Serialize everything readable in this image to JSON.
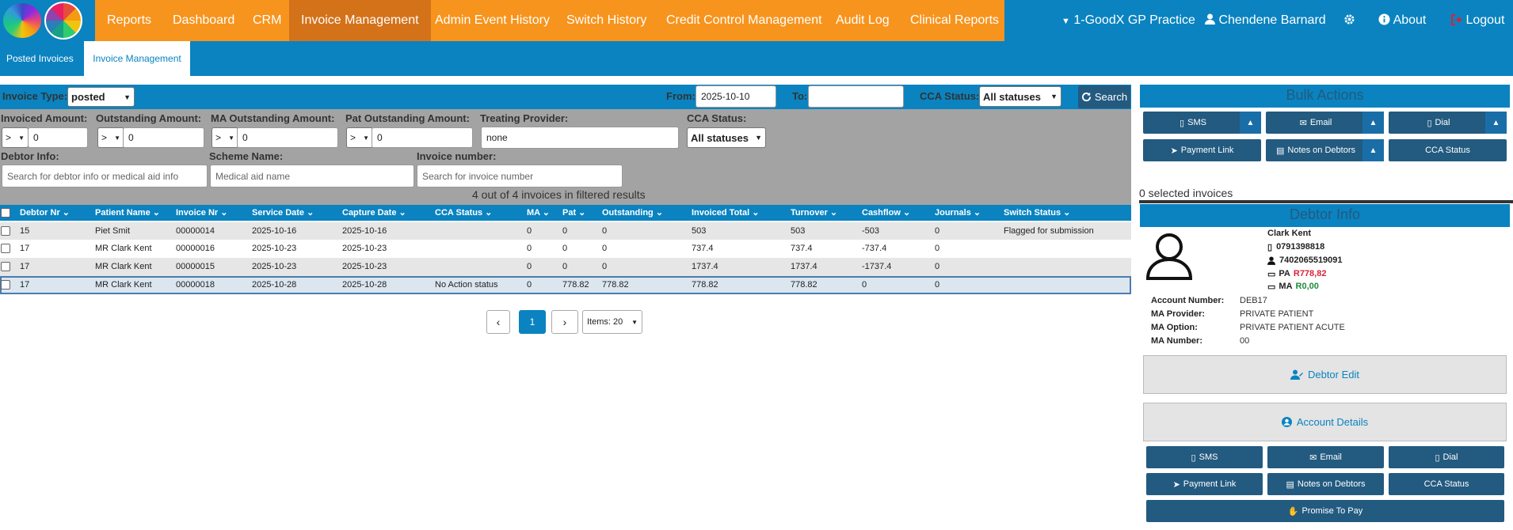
{
  "nav": {
    "items": [
      "Reports",
      "Dashboard",
      "CRM",
      "Invoice Management",
      "Admin Event History",
      "Switch History",
      "Credit Control Management",
      "Audit Log",
      "Clinical Reports"
    ],
    "practice": "1-GoodX GP Practice",
    "user": "Chendene Barnard",
    "about": "About",
    "logout": "Logout"
  },
  "subnav": {
    "tabs": [
      "Posted Invoices",
      "Invoice Management"
    ]
  },
  "filters": {
    "invoice_type_label": "Invoice Type:",
    "invoice_type_value": "posted",
    "from_label": "From:",
    "from_value": "2025-10-10",
    "to_label": "To:",
    "to_value": "",
    "cca_status_label": "CCA Status:",
    "cca_status_value": "All statuses",
    "search_label": "Search",
    "invoiced_amount_label": "Invoiced Amount:",
    "outstanding_amount_label": "Outstanding Amount:",
    "ma_outstanding_label": "MA Outstanding Amount:",
    "pat_outstanding_label": "Pat Outstanding Amount:",
    "operator": ">",
    "amount_value": "0",
    "treating_provider_label": "Treating Provider:",
    "treating_provider_value": "none",
    "cca_status2_label": "CCA Status:",
    "cca_status2_value": "All statuses",
    "debtor_info_label": "Debtor Info:",
    "debtor_info_placeholder": "Search for debtor info or medical aid info",
    "scheme_name_label": "Scheme Name:",
    "scheme_name_placeholder": "Medical aid name",
    "invoice_number_label": "Invoice number:",
    "invoice_number_placeholder": "Search for invoice number"
  },
  "results_count": "4 out of 4 invoices in filtered results",
  "table": {
    "columns": [
      "Debtor Nr",
      "Patient Name",
      "Invoice Nr",
      "Service Date",
      "Capture Date",
      "CCA Status",
      "MA",
      "Pat",
      "Outstanding",
      "Invoiced Total",
      "Turnover",
      "Cashflow",
      "Journals",
      "Switch Status"
    ],
    "rows": [
      [
        "15",
        "Piet Smit",
        "00000014",
        "2025-10-16",
        "2025-10-16",
        "",
        "0",
        "0",
        "0",
        "503",
        "503",
        "-503",
        "0",
        "Flagged for submission"
      ],
      [
        "17",
        "MR Clark Kent",
        "00000016",
        "2025-10-23",
        "2025-10-23",
        "",
        "0",
        "0",
        "0",
        "737.4",
        "737.4",
        "-737.4",
        "0",
        ""
      ],
      [
        "17",
        "MR Clark Kent",
        "00000015",
        "2025-10-23",
        "2025-10-23",
        "",
        "0",
        "0",
        "0",
        "1737.4",
        "1737.4",
        "-1737.4",
        "0",
        ""
      ],
      [
        "17",
        "MR Clark Kent",
        "00000018",
        "2025-10-28",
        "2025-10-28",
        "No Action status",
        "0",
        "778.82",
        "778.82",
        "778.82",
        "778.82",
        "0",
        "0",
        ""
      ]
    ]
  },
  "pagination": {
    "page": "1",
    "items_label": "Items: 20"
  },
  "bulk": {
    "title": "Bulk Actions",
    "sms": "SMS",
    "email": "Email",
    "dial": "Dial",
    "payment_link": "Payment Link",
    "notes": "Notes on Debtors",
    "cca_status": "CCA Status",
    "selected": "0 selected invoices"
  },
  "debtor": {
    "title": "Debtor Info",
    "name": "Clark Kent",
    "phone": "0791398818",
    "id_number": "7402065519091",
    "pa_label": "PA",
    "pa_value": "R778,82",
    "ma_label": "MA",
    "ma_value": "R0,00",
    "account_number_label": "Account Number:",
    "account_number": "DEB17",
    "ma_provider_label": "MA Provider:",
    "ma_provider": "PRIVATE PATIENT",
    "ma_option_label": "MA Option:",
    "ma_option": "PRIVATE PATIENT ACUTE",
    "ma_number_label": "MA Number:",
    "ma_number": "00",
    "debtor_edit": "Debtor Edit",
    "account_details": "Account Details",
    "sms": "SMS",
    "email": "Email",
    "dial": "Dial",
    "payment_link": "Payment Link",
    "notes": "Notes on Debtors",
    "cca_status": "CCA Status",
    "promise": "Promise To Pay"
  },
  "colors": {
    "orange": "#f7941d",
    "blue": "#0a83c0",
    "navy": "#235a80",
    "red": "#d9223a",
    "green": "#1f8a3a"
  }
}
